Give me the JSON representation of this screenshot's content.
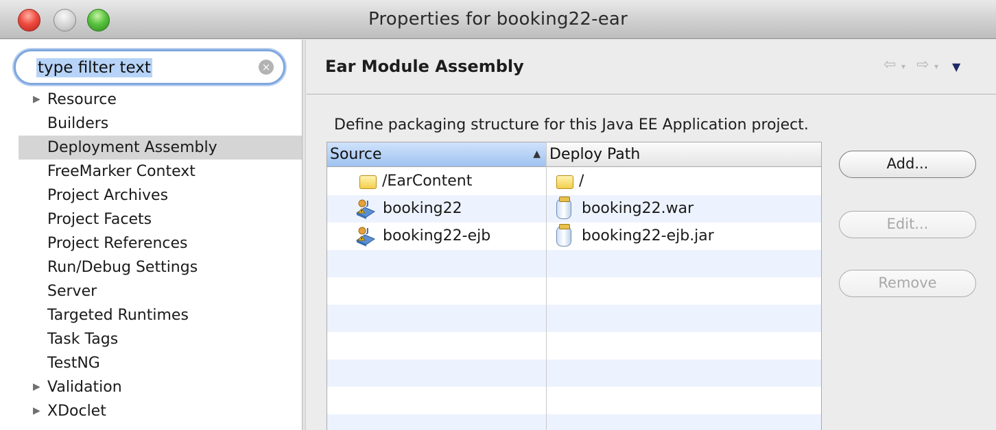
{
  "window": {
    "title": "Properties for booking22-ear"
  },
  "filter": {
    "value": "type filter text"
  },
  "tree": {
    "items": [
      {
        "label": "Resource",
        "expandable": true,
        "selected": false
      },
      {
        "label": "Builders",
        "expandable": false,
        "selected": false
      },
      {
        "label": "Deployment Assembly",
        "expandable": false,
        "selected": true
      },
      {
        "label": "FreeMarker Context",
        "expandable": false,
        "selected": false
      },
      {
        "label": "Project Archives",
        "expandable": false,
        "selected": false
      },
      {
        "label": "Project Facets",
        "expandable": false,
        "selected": false
      },
      {
        "label": "Project References",
        "expandable": false,
        "selected": false
      },
      {
        "label": "Run/Debug Settings",
        "expandable": false,
        "selected": false
      },
      {
        "label": "Server",
        "expandable": false,
        "selected": false
      },
      {
        "label": "Targeted Runtimes",
        "expandable": false,
        "selected": false
      },
      {
        "label": "Task Tags",
        "expandable": false,
        "selected": false
      },
      {
        "label": "TestNG",
        "expandable": false,
        "selected": false
      },
      {
        "label": "Validation",
        "expandable": true,
        "selected": false
      },
      {
        "label": "XDoclet",
        "expandable": true,
        "selected": false
      }
    ]
  },
  "page": {
    "title": "Ear Module Assembly",
    "description": "Define packaging structure for this Java EE Application project."
  },
  "table": {
    "columns": {
      "source": "Source",
      "deploy": "Deploy Path"
    },
    "rows": [
      {
        "source": "/EarContent",
        "source_icon": "folder-icon",
        "deploy": "/",
        "deploy_icon": "folder-icon"
      },
      {
        "source": "booking22",
        "source_icon": "web-project-icon",
        "deploy": "booking22.war",
        "deploy_icon": "archive-jar-icon"
      },
      {
        "source": "booking22-ejb",
        "source_icon": "ejb-project-icon",
        "deploy": "booking22-ejb.jar",
        "deploy_icon": "archive-jar-icon"
      }
    ],
    "empty_row_count": 7
  },
  "buttons": {
    "add": "Add...",
    "edit": "Edit...",
    "remove": "Remove"
  },
  "colors": {
    "selection": "#b7d3f7",
    "header_active": "#9fc3f0",
    "row_stripe": "#edf3fe"
  }
}
